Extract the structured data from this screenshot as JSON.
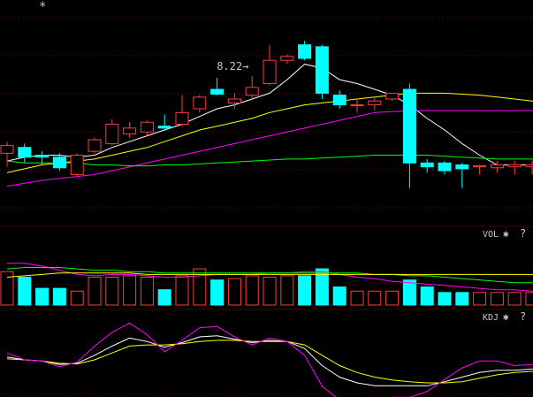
{
  "header": {
    "marker": "*"
  },
  "panels": {
    "vol": {
      "label": "VOL"
    },
    "kdj": {
      "label": "KDJ"
    },
    "gear_symbol": "✱",
    "help_symbol": "?"
  },
  "icons": {
    "settings": "gear-icon",
    "help": "help-icon"
  },
  "colors": {
    "up": "#ff3c3c",
    "down": "#00ffff",
    "ma1": "#ffffff",
    "ma2": "#ffff00",
    "ma3": "#ff00ff",
    "ma4": "#00ff00",
    "k": "#ffffff",
    "d": "#ffff00",
    "j": "#ff00ff",
    "grid": "#5a0000",
    "text": "#c8c8c8"
  },
  "chart_data": [
    {
      "type": "candlestick",
      "annotation": {
        "text": "8.22→",
        "candle_index": 14
      },
      "ylim": [
        6.4,
        8.5
      ],
      "candles": [
        {
          "o": 7.1,
          "h": 7.22,
          "l": 6.96,
          "c": 7.18
        },
        {
          "o": 7.16,
          "h": 7.2,
          "l": 7.0,
          "c": 7.06
        },
        {
          "o": 7.08,
          "h": 7.12,
          "l": 6.98,
          "c": 7.06
        },
        {
          "o": 7.06,
          "h": 7.1,
          "l": 6.92,
          "c": 6.95
        },
        {
          "o": 6.88,
          "h": 7.1,
          "l": 6.86,
          "c": 7.08
        },
        {
          "o": 7.12,
          "h": 7.26,
          "l": 7.1,
          "c": 7.24
        },
        {
          "o": 7.2,
          "h": 7.45,
          "l": 7.18,
          "c": 7.4
        },
        {
          "o": 7.3,
          "h": 7.42,
          "l": 7.26,
          "c": 7.36
        },
        {
          "o": 7.32,
          "h": 7.44,
          "l": 7.28,
          "c": 7.42
        },
        {
          "o": 7.38,
          "h": 7.5,
          "l": 7.34,
          "c": 7.36
        },
        {
          "o": 7.4,
          "h": 7.7,
          "l": 7.38,
          "c": 7.52
        },
        {
          "o": 7.56,
          "h": 7.7,
          "l": 7.52,
          "c": 7.68
        },
        {
          "o": 7.76,
          "h": 7.88,
          "l": 7.7,
          "c": 7.71
        },
        {
          "o": 7.62,
          "h": 7.72,
          "l": 7.56,
          "c": 7.66
        },
        {
          "o": 7.7,
          "h": 7.9,
          "l": 7.66,
          "c": 7.78
        },
        {
          "o": 7.82,
          "h": 8.22,
          "l": 7.8,
          "c": 8.06
        },
        {
          "o": 8.06,
          "h": 8.12,
          "l": 8.02,
          "c": 8.1
        },
        {
          "o": 8.22,
          "h": 8.26,
          "l": 8.06,
          "c": 8.08
        },
        {
          "o": 8.2,
          "h": 8.22,
          "l": 7.66,
          "c": 7.72
        },
        {
          "o": 7.7,
          "h": 7.75,
          "l": 7.56,
          "c": 7.6
        },
        {
          "o": 7.6,
          "h": 7.66,
          "l": 7.52,
          "c": 7.6
        },
        {
          "o": 7.6,
          "h": 7.69,
          "l": 7.54,
          "c": 7.64
        },
        {
          "o": 7.66,
          "h": 7.72,
          "l": 7.64,
          "c": 7.72
        },
        {
          "o": 7.76,
          "h": 7.82,
          "l": 6.74,
          "c": 7.0
        },
        {
          "o": 7.0,
          "h": 7.04,
          "l": 6.9,
          "c": 6.96
        },
        {
          "o": 7.0,
          "h": 7.02,
          "l": 6.88,
          "c": 6.92
        },
        {
          "o": 6.98,
          "h": 7.0,
          "l": 6.74,
          "c": 6.94
        },
        {
          "o": 6.96,
          "h": 6.98,
          "l": 6.88,
          "c": 6.97
        },
        {
          "o": 6.95,
          "h": 7.02,
          "l": 6.9,
          "c": 6.98
        },
        {
          "o": 6.96,
          "h": 7.02,
          "l": 6.88,
          "c": 6.98
        },
        {
          "o": 6.96,
          "h": 7.02,
          "l": 6.88,
          "c": 6.98
        },
        {
          "o": 6.96,
          "h": 7.1,
          "l": 6.84,
          "c": 7.08
        }
      ],
      "ma": [
        {
          "name": "MA1",
          "values": [
            7.02,
            7.06,
            7.08,
            7.08,
            7.06,
            7.08,
            7.16,
            7.22,
            7.28,
            7.34,
            7.4,
            7.48,
            7.56,
            7.6,
            7.66,
            7.72,
            7.86,
            8.02,
            7.98,
            7.86,
            7.82,
            7.76,
            7.7,
            7.6,
            7.46,
            7.34,
            7.2,
            7.08,
            6.98,
            6.98,
            6.98,
            6.98
          ]
        },
        {
          "name": "MA2",
          "values": [
            6.9,
            6.94,
            6.98,
            7.0,
            7.02,
            7.04,
            7.08,
            7.12,
            7.16,
            7.22,
            7.28,
            7.34,
            7.38,
            7.42,
            7.46,
            7.52,
            7.56,
            7.6,
            7.62,
            7.64,
            7.66,
            7.68,
            7.7,
            7.72,
            7.72,
            7.72,
            7.71,
            7.7,
            7.68,
            7.66,
            7.64,
            7.62
          ]
        },
        {
          "name": "MA3",
          "values": [
            6.76,
            6.79,
            6.82,
            6.84,
            6.86,
            6.88,
            6.92,
            6.96,
            7.0,
            7.04,
            7.08,
            7.12,
            7.16,
            7.2,
            7.24,
            7.28,
            7.32,
            7.36,
            7.4,
            7.44,
            7.48,
            7.52,
            7.53,
            7.54,
            7.54,
            7.54,
            7.54,
            7.54,
            7.54,
            7.54,
            7.54,
            7.54
          ]
        },
        {
          "name": "MA4",
          "values": [
            7.02,
            7.0,
            7.0,
            7.0,
            7.0,
            6.98,
            6.98,
            6.97,
            6.97,
            6.98,
            6.98,
            6.99,
            7.0,
            7.01,
            7.02,
            7.03,
            7.04,
            7.04,
            7.05,
            7.06,
            7.07,
            7.08,
            7.08,
            7.08,
            7.08,
            7.07,
            7.06,
            7.05,
            7.04,
            7.04,
            7.04,
            7.04
          ]
        }
      ]
    },
    {
      "type": "bar",
      "name": "VOL",
      "ylim": [
        0,
        40
      ],
      "values": [
        24,
        20,
        12,
        12,
        10,
        20,
        20,
        21,
        20,
        11,
        21,
        26,
        18,
        19,
        21,
        20,
        21,
        21,
        26,
        13,
        10,
        10,
        10,
        18,
        13,
        9,
        9,
        9,
        9,
        9,
        9,
        9
      ],
      "ma": [
        {
          "name": "MA1",
          "values": [
            30,
            30,
            28,
            25,
            22,
            21,
            22,
            22,
            21,
            20,
            20,
            21,
            22,
            22,
            22,
            23,
            23,
            24,
            24,
            22,
            20,
            19,
            17,
            16,
            15,
            14,
            13,
            12,
            11,
            11,
            10,
            10
          ]
        },
        {
          "name": "MA2",
          "values": [
            26,
            27,
            27,
            27,
            26,
            25,
            25,
            24,
            24,
            23,
            23,
            23,
            23,
            23,
            23,
            23,
            23,
            23,
            23,
            23,
            23,
            22,
            22,
            21,
            21,
            20,
            19,
            18,
            17,
            16,
            16,
            15
          ]
        },
        {
          "name": "MA3",
          "values": [
            20,
            21,
            22,
            23,
            23,
            23,
            23,
            23,
            22,
            22,
            22,
            22,
            22,
            22,
            22,
            22,
            22,
            22,
            22,
            22,
            22,
            22,
            22,
            22,
            22,
            22,
            22,
            22,
            22,
            22,
            22,
            22
          ]
        }
      ]
    },
    {
      "type": "line",
      "name": "KDJ",
      "ylim": [
        -20,
        120
      ],
      "series": [
        {
          "name": "K",
          "values": [
            45,
            40,
            38,
            32,
            34,
            48,
            64,
            78,
            72,
            62,
            70,
            80,
            82,
            76,
            70,
            74,
            72,
            60,
            30,
            10,
            0,
            -5,
            -5,
            -5,
            -5,
            2,
            10,
            18,
            22,
            22,
            24,
            30
          ]
        },
        {
          "name": "D",
          "values": [
            42,
            40,
            38,
            34,
            33,
            40,
            52,
            64,
            66,
            66,
            68,
            72,
            74,
            74,
            72,
            72,
            72,
            66,
            48,
            30,
            18,
            10,
            5,
            2,
            0,
            0,
            2,
            8,
            14,
            18,
            20,
            24
          ]
        },
        {
          "name": "J",
          "values": [
            52,
            40,
            38,
            28,
            36,
            64,
            88,
            104,
            84,
            54,
            74,
            96,
            98,
            80,
            66,
            78,
            72,
            48,
            -6,
            -30,
            -36,
            -35,
            -25,
            -25,
            -15,
            6,
            26,
            38,
            38,
            30,
            32,
            42
          ]
        }
      ]
    }
  ]
}
